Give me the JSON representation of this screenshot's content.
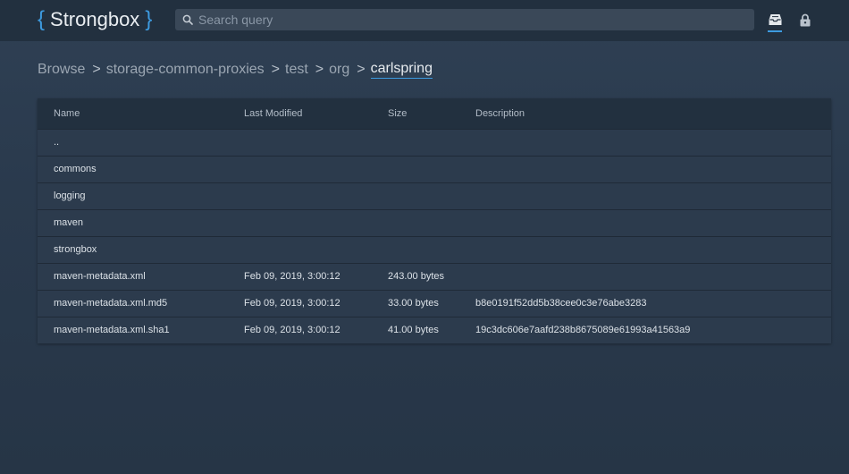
{
  "header": {
    "logo_brace_open": "{",
    "logo_text": "Strongbox",
    "logo_brace_close": "}",
    "search_placeholder": "Search query",
    "search_value": "",
    "icons": [
      "inbox-icon",
      "lock-icon"
    ]
  },
  "breadcrumb": {
    "root": "Browse",
    "separator": ">",
    "items": [
      "storage-common-proxies",
      "test",
      "org"
    ],
    "current": "carlspring"
  },
  "table": {
    "columns": [
      "Name",
      "Last Modified",
      "Size",
      "Description"
    ],
    "rows": [
      {
        "name": "..",
        "modified": "",
        "size": "",
        "description": ""
      },
      {
        "name": "commons",
        "modified": "",
        "size": "",
        "description": ""
      },
      {
        "name": "logging",
        "modified": "",
        "size": "",
        "description": ""
      },
      {
        "name": "maven",
        "modified": "",
        "size": "",
        "description": ""
      },
      {
        "name": "strongbox",
        "modified": "",
        "size": "",
        "description": ""
      },
      {
        "name": "maven-metadata.xml",
        "modified": "Feb 09, 2019, 3:00:12",
        "size": "243.00 bytes",
        "description": ""
      },
      {
        "name": "maven-metadata.xml.md5",
        "modified": "Feb 09, 2019, 3:00:12",
        "size": "33.00 bytes",
        "description": "b8e0191f52dd5b38cee0c3e76abe3283"
      },
      {
        "name": "maven-metadata.xml.sha1",
        "modified": "Feb 09, 2019, 3:00:12",
        "size": "41.00 bytes",
        "description": "19c3dc606e7aafd238b8675089e61993a41563a9"
      }
    ]
  },
  "colors": {
    "accent": "#3d9be0",
    "topbar": "#22303f",
    "panel": "#2c3b4d"
  }
}
